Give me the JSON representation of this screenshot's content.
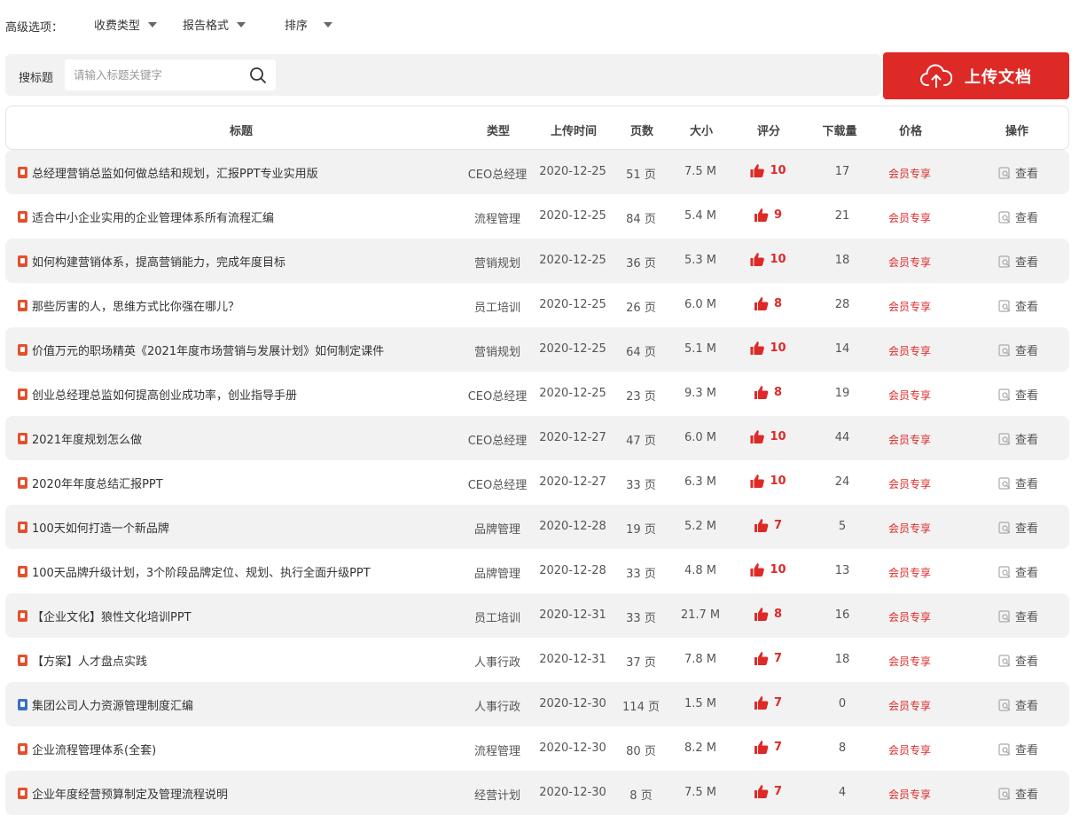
{
  "filters": {
    "label": "高级选项：",
    "dropdowns": [
      "收费类型",
      "报告格式",
      "排序"
    ]
  },
  "search": {
    "label": "搜标题",
    "placeholder": "请输入标题关键字",
    "icon": "search-icon"
  },
  "upload": {
    "label": "上传文档",
    "icon": "cloud-upload-icon",
    "color": "#dd2a27"
  },
  "columns": [
    "标题",
    "类型",
    "上传时间",
    "页数",
    "大小",
    "评分",
    "下载量",
    "价格",
    "操作"
  ],
  "colors": {
    "accent": "#dd2a27",
    "row_alt_bg": "#f2f2f2",
    "ppt_icon": "#e2512e",
    "doc_icon": "#3b6fc6"
  },
  "rows": [
    {
      "title": "总经理营销总监如何做总结和规划，汇报PPT专业实用版",
      "file": "ppt",
      "type": "CEO总经理",
      "date": "2020-12-25",
      "pages": "51 页",
      "size": "7.5 M",
      "score": "10",
      "downloads": "17",
      "price": "会员专享",
      "action": "查看"
    },
    {
      "title": "适合中小企业实用的企业管理体系所有流程汇编",
      "file": "ppt",
      "type": "流程管理",
      "date": "2020-12-25",
      "pages": "84 页",
      "size": "5.4 M",
      "score": "9",
      "downloads": "21",
      "price": "会员专享",
      "action": "查看"
    },
    {
      "title": "如何构建营销体系，提高营销能力，完成年度目标",
      "file": "ppt",
      "type": "营销规划",
      "date": "2020-12-25",
      "pages": "36 页",
      "size": "5.3 M",
      "score": "10",
      "downloads": "18",
      "price": "会员专享",
      "action": "查看"
    },
    {
      "title": "那些厉害的人，思维方式比你强在哪儿？",
      "file": "ppt",
      "type": "员工培训",
      "date": "2020-12-25",
      "pages": "26 页",
      "size": "6.0 M",
      "score": "8",
      "downloads": "28",
      "price": "会员专享",
      "action": "查看"
    },
    {
      "title": "价值万元的职场精英《2021年度市场营销与发展计划》如何制定课件",
      "file": "ppt",
      "type": "营销规划",
      "date": "2020-12-25",
      "pages": "64 页",
      "size": "5.1 M",
      "score": "10",
      "downloads": "14",
      "price": "会员专享",
      "action": "查看"
    },
    {
      "title": "创业总经理总监如何提高创业成功率，创业指导手册",
      "file": "ppt",
      "type": "CEO总经理",
      "date": "2020-12-25",
      "pages": "23 页",
      "size": "9.3 M",
      "score": "8",
      "downloads": "19",
      "price": "会员专享",
      "action": "查看"
    },
    {
      "title": "2021年度规划怎么做",
      "file": "ppt",
      "type": "CEO总经理",
      "date": "2020-12-27",
      "pages": "47 页",
      "size": "6.0 M",
      "score": "10",
      "downloads": "44",
      "price": "会员专享",
      "action": "查看"
    },
    {
      "title": "2020年年度总结汇报PPT",
      "file": "ppt",
      "type": "CEO总经理",
      "date": "2020-12-27",
      "pages": "33 页",
      "size": "6.3 M",
      "score": "10",
      "downloads": "24",
      "price": "会员专享",
      "action": "查看"
    },
    {
      "title": "100天如何打造一个新品牌",
      "file": "ppt",
      "type": "品牌管理",
      "date": "2020-12-28",
      "pages": "19 页",
      "size": "5.2 M",
      "score": "7",
      "downloads": "5",
      "price": "会员专享",
      "action": "查看"
    },
    {
      "title": "100天品牌升级计划，3个阶段品牌定位、规划、执行全面升级PPT",
      "file": "ppt",
      "type": "品牌管理",
      "date": "2020-12-28",
      "pages": "33 页",
      "size": "4.8 M",
      "score": "10",
      "downloads": "13",
      "price": "会员专享",
      "action": "查看"
    },
    {
      "title": "【企业文化】狼性文化培训PPT",
      "file": "ppt",
      "type": "员工培训",
      "date": "2020-12-31",
      "pages": "33 页",
      "size": "21.7 M",
      "score": "8",
      "downloads": "16",
      "price": "会员专享",
      "action": "查看"
    },
    {
      "title": "【方案】人才盘点实践",
      "file": "ppt",
      "type": "人事行政",
      "date": "2020-12-31",
      "pages": "37 页",
      "size": "7.8 M",
      "score": "7",
      "downloads": "18",
      "price": "会员专享",
      "action": "查看"
    },
    {
      "title": "集团公司人力资源管理制度汇编",
      "file": "doc",
      "type": "人事行政",
      "date": "2020-12-30",
      "pages": "114 页",
      "size": "1.5 M",
      "score": "7",
      "downloads": "0",
      "price": "会员专享",
      "action": "查看"
    },
    {
      "title": "企业流程管理体系(全套)",
      "file": "ppt",
      "type": "流程管理",
      "date": "2020-12-30",
      "pages": "80 页",
      "size": "8.2 M",
      "score": "7",
      "downloads": "8",
      "price": "会员专享",
      "action": "查看"
    },
    {
      "title": "企业年度经营预算制定及管理流程说明",
      "file": "ppt",
      "type": "经营计划",
      "date": "2020-12-30",
      "pages": "8 页",
      "size": "7.5 M",
      "score": "7",
      "downloads": "4",
      "price": "会员专享",
      "action": "查看"
    }
  ]
}
